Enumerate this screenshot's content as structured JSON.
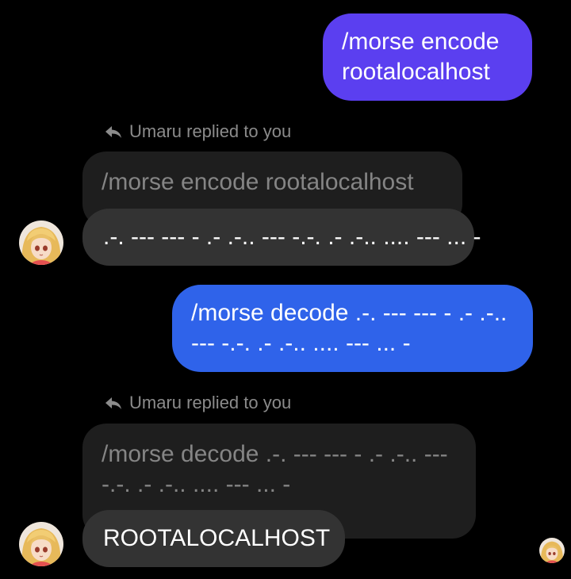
{
  "messages": {
    "sent_1": "/morse encode\nrootalocalhost",
    "reply_label_1": "Umaru replied to you",
    "quoted_1": "/morse encode rootalocalhost",
    "received_1": ".-. --- --- - .- .-.. --- -.-. .- .-.. .... --- ... -",
    "sent_2": "/morse decode .-. --- --- - .- .-..\n--- -.-. .- .-.. .... --- ... -",
    "reply_label_2": "Umaru replied to you",
    "quoted_2": "/morse decode .-. --- --- - .- .-.. ---\n-.-. .- .-.. .... --- ... -",
    "received_2": "ROOTALOCALHOST"
  },
  "colors": {
    "background": "#000000",
    "sent_bubble_1": "#5b3ff0",
    "sent_bubble_2": "#2f63ea",
    "received_bubble": "#333333",
    "quoted_bubble": "#1e1e1e",
    "muted_text": "#8b8b8b"
  },
  "icons": {
    "reply": "reply-arrow-icon",
    "avatar": "anime-girl-avatar"
  }
}
